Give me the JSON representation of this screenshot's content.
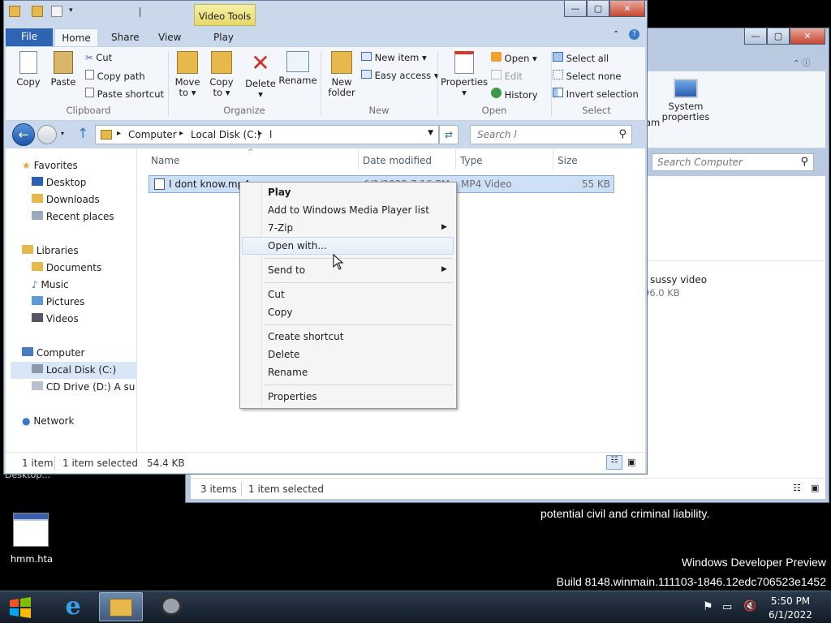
{
  "desktop": {
    "legal_text": "potential civil and criminal liability.",
    "watermark_line1": "Windows Developer Preview",
    "watermark_line2": "Build 8148.winmain.111103-1846.12edc706523e1452",
    "icon_label": "hmm.hta",
    "behind_label": "Desktop..."
  },
  "back_window": {
    "ribbon_item": "System properties",
    "ribbon_item_prefix": "am",
    "search_placeholder": "Search Computer",
    "item_name": "sussy video",
    "item_size": "96.0 KB",
    "status_items": "3 items",
    "status_selected": "1 item selected"
  },
  "explorer": {
    "context_tab": "Video Tools",
    "tabs": [
      "File",
      "Home",
      "Share",
      "View",
      "Play"
    ],
    "clipboard": {
      "copy": "Copy",
      "paste": "Paste",
      "cut": "Cut",
      "copy_path": "Copy path",
      "paste_shortcut": "Paste shortcut",
      "group": "Clipboard"
    },
    "organize": {
      "move_to": "Move",
      "move_to_2": "to ▾",
      "copy_to": "Copy",
      "copy_to_2": "to ▾",
      "delete": "Delete",
      "delete_2": "▾",
      "rename": "Rename",
      "group": "Organize"
    },
    "new": {
      "new_folder": "New",
      "new_folder_2": "folder",
      "new_item": "New item ▾",
      "easy_access": "Easy access ▾",
      "group": "New"
    },
    "open": {
      "properties": "Properties",
      "properties_2": "▾",
      "open": "Open ▾",
      "edit": "Edit",
      "history": "History",
      "group": "Open"
    },
    "select": {
      "select_all": "Select all",
      "select_none": "Select none",
      "invert": "Invert selection",
      "group": "Select"
    },
    "address": [
      "Computer",
      "Local Disk (C:)",
      "l"
    ],
    "search_placeholder": "Search l",
    "nav": {
      "favorites": "Favorites",
      "desktop": "Desktop",
      "downloads": "Downloads",
      "recent": "Recent places",
      "libraries": "Libraries",
      "documents": "Documents",
      "music": "Music",
      "pictures": "Pictures",
      "videos": "Videos",
      "computer": "Computer",
      "local_disk": "Local Disk (C:)",
      "cd_drive": "CD Drive (D:) A sussy",
      "network": "Network"
    },
    "columns": [
      "Name",
      "Date modified",
      "Type",
      "Size"
    ],
    "file": {
      "name": "I dont know.mp4",
      "date": "6/1/2022 7:16 PM",
      "type": "MP4 Video",
      "size": "55 KB"
    },
    "status_items": "1 item",
    "status_selected": "1 item selected",
    "status_size": "54.4 KB"
  },
  "context_menu": {
    "play": "Play",
    "add_wmp": "Add to Windows Media Player list",
    "zip": "7-Zip",
    "open_with": "Open with...",
    "send_to": "Send to",
    "cut": "Cut",
    "copy": "Copy",
    "create_shortcut": "Create shortcut",
    "delete": "Delete",
    "rename": "Rename",
    "properties": "Properties"
  },
  "taskbar": {
    "time": "5:50 PM",
    "date": "6/1/2022"
  }
}
